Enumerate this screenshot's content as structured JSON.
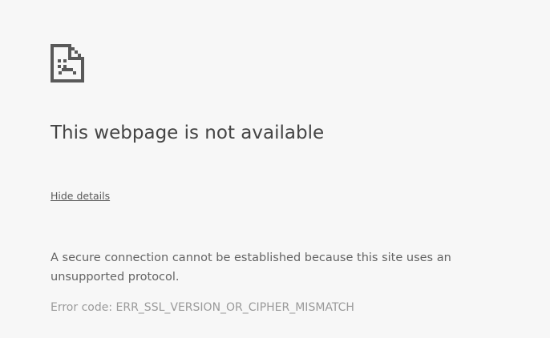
{
  "icon": "sad-page-icon",
  "colors": {
    "background": "#f7f7f7",
    "icon": "#595959",
    "title": "#444444",
    "body_text": "#646464",
    "error_code": "#9a9a9a"
  },
  "title": "This webpage is not available",
  "details_toggle_label": "Hide details",
  "details_message": "A secure connection cannot be established because this site uses an unsupported protocol.",
  "error_code_text": "Error code: ERR_SSL_VERSION_OR_CIPHER_MISMATCH"
}
